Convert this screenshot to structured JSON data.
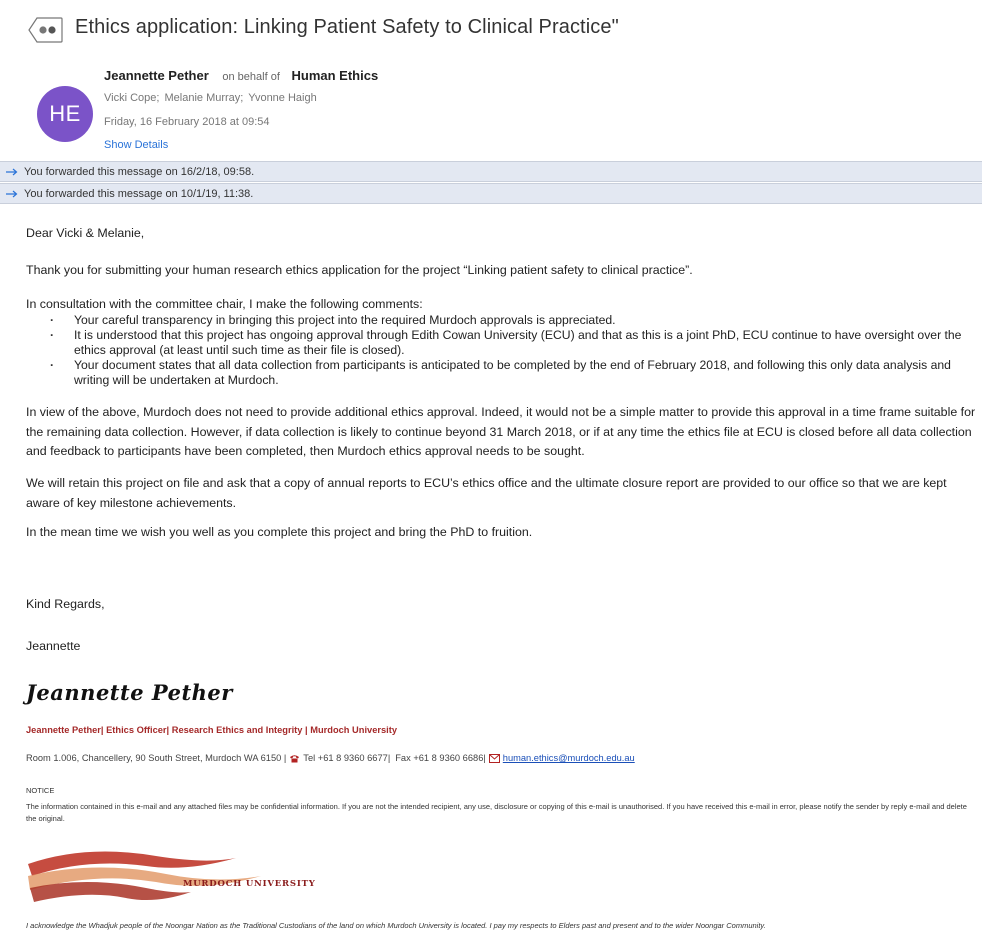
{
  "subject": {
    "title": "Ethics application: Linking Patient Safety to Clinical Practice\""
  },
  "header": {
    "avatar_initials": "HE",
    "sender_name": "Jeannette Pether",
    "on_behalf": "on behalf of",
    "sender_org": "Human Ethics",
    "recipients": [
      "Vicki Cope;",
      "Melanie Murray;",
      "Yvonne Haigh"
    ],
    "date": "Friday, 16 February 2018 at 09:54",
    "show_details": "Show Details"
  },
  "forwards": [
    "You forwarded this message on 16/2/18, 09:58.",
    "You forwarded this message on 10/1/19, 11:38."
  ],
  "body": {
    "greeting": "Dear Vicki & Melanie,",
    "para1": "Thank you for submitting your human research ethics application for the project “Linking patient safety to clinical practice”.",
    "para2": "In consultation with the committee chair, I make the following comments:",
    "bullets": [
      "Your careful transparency in bringing this project into the required Murdoch approvals is appreciated.",
      "It is understood that this project has ongoing approval through Edith Cowan University (ECU) and that as this is a joint PhD, ECU continue to have oversight over the ethics approval (at least until such time as their file is closed).",
      "Your document states that all data collection from participants is anticipated to be completed by the end of February 2018, and following this only data analysis and writing will be undertaken at Murdoch."
    ],
    "para3": "In view of the above, Murdoch does not need to provide additional ethics approval. Indeed, it would not be a simple matter to provide this approval in a time frame suitable for the remaining data collection. However, if data collection is likely to continue beyond 31 March 2018, or if at any time the ethics file at ECU is closed before all data collection and feedback to participants have been completed, then Murdoch ethics approval needs to be sought.",
    "para4": "We will retain this project on file and ask that a copy of annual reports to ECU’s ethics office and the ultimate closure report are provided to our office so that we are kept aware of key milestone achievements.",
    "para5": "In the mean time we wish you well as you complete this project and bring the PhD to fruition.",
    "closing": "Kind Regards,",
    "first_name": "Jeannette"
  },
  "signature": {
    "script_name": "Jeannette Pether",
    "title_line": "Jeannette Pether| Ethics Officer| Research Ethics and Integrity | Murdoch University",
    "address": "Room 1.006, Chancellery, 90 South Street, Murdoch WA 6150 |",
    "tel": "Tel +61 8 9360 6677|",
    "fax": "Fax +61 8 9360 6686|",
    "email": "human.ethics@murdoch.edu.au",
    "notice_head": "NOTICE",
    "notice_text": "The information contained in this e-mail and any attached files may be confidential information. If you are not the intended recipient, any use, disclosure or copying of this e-mail is unauthorised. If you have received this e-mail in error, please notify the sender by reply e-mail and delete the original.",
    "logo_text": "MURDOCH UNIVERSITY",
    "acknowledgement": "I acknowledge the Whadjuk people of the Noongar Nation as the Traditional Custodians of the land on which Murdoch University is located. I pay my respects to Elders past and present and to the wider Noongar Community."
  },
  "colors": {
    "avatar": "#7b53c8",
    "link": "#2a73d8",
    "banner": "#e3e8f2",
    "signature_red": "#a52a2a"
  }
}
